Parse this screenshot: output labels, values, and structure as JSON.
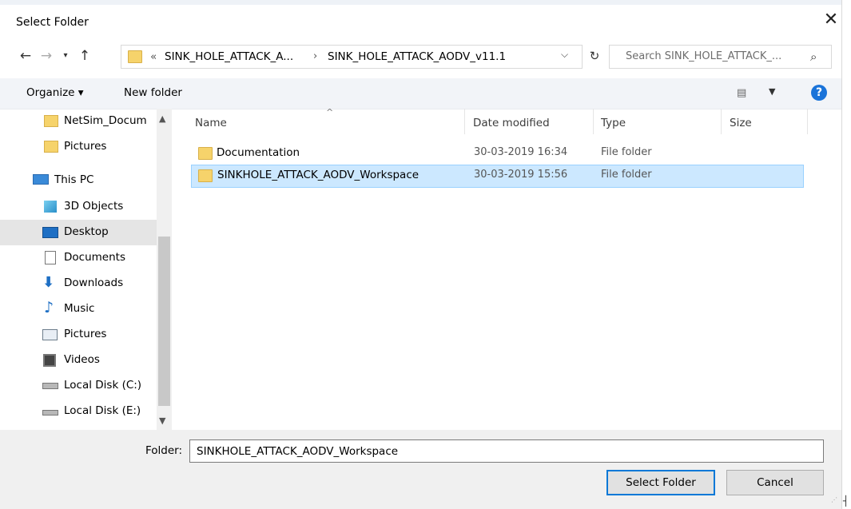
{
  "title": "Select Folder",
  "address": {
    "overflow": "«",
    "crumbs": [
      "SINK_HOLE_ATTACK_A...",
      "SINK_HOLE_ATTACK_AODV_v11.1"
    ]
  },
  "search": {
    "placeholder": "Search SINK_HOLE_ATTACK_..."
  },
  "toolbar": {
    "organize": "Organize ▾",
    "new_folder": "New folder"
  },
  "sidebar": {
    "items": [
      {
        "label": "NetSim_Docum",
        "icon": "folder-icon"
      },
      {
        "label": "Pictures",
        "icon": "folder-icon"
      },
      {
        "label": "This PC",
        "icon": "computer-icon"
      },
      {
        "label": "3D Objects",
        "icon": "cube-icon"
      },
      {
        "label": "Desktop",
        "icon": "desktop-icon",
        "selected": true
      },
      {
        "label": "Documents",
        "icon": "documents-icon"
      },
      {
        "label": "Downloads",
        "icon": "download-arrow-icon"
      },
      {
        "label": "Music",
        "icon": "music-note-icon"
      },
      {
        "label": "Pictures",
        "icon": "pictures-icon"
      },
      {
        "label": "Videos",
        "icon": "film-icon"
      },
      {
        "label": "Local Disk (C:)",
        "icon": "disk-drive-icon"
      },
      {
        "label": "Local Disk (E:)",
        "icon": "disk-drive-icon"
      }
    ]
  },
  "columns": {
    "name": "Name",
    "date": "Date modified",
    "type": "Type",
    "size": "Size"
  },
  "files": [
    {
      "name": "Documentation",
      "date": "30-03-2019 16:34",
      "type": "File folder"
    },
    {
      "name": "SINKHOLE_ATTACK_AODV_Workspace",
      "date": "30-03-2019 15:56",
      "type": "File folder",
      "selected": true
    }
  ],
  "footer": {
    "folder_label": "Folder:",
    "folder_value": "SINKHOLE_ATTACK_AODV_Workspace",
    "select_button": "Select Folder",
    "cancel_button": "Cancel"
  },
  "colors": {
    "accent": "#0078d7",
    "selection": "#cce8ff",
    "folder": "#f6d36b"
  }
}
